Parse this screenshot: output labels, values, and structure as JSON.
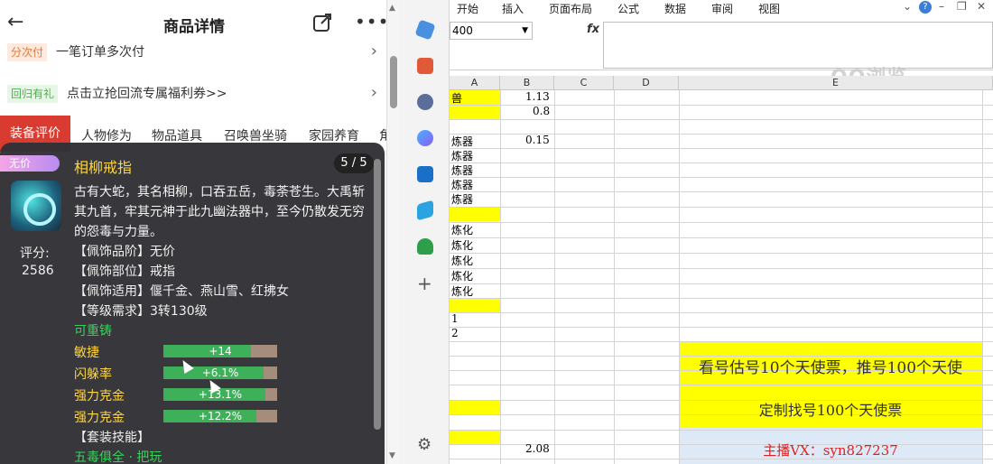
{
  "phone": {
    "title": "商品详情",
    "row1": {
      "tag": "分次付",
      "text": "一笔订单多次付"
    },
    "row2": {
      "tag": "回归有礼",
      "text": "点击立抢回流专属福利券>>"
    },
    "tabs": [
      "装备评价",
      "人物修为",
      "物品道具",
      "召唤兽坐骑",
      "家园养育",
      "角"
    ]
  },
  "card": {
    "badge": "无价",
    "name": "相柳戒指",
    "page": "5 / 5",
    "description": "古有大蛇，其名相柳，口吞五岳，毒荼苍生。大禹斩其九首，牢其元神于此九幽法器中，至今仍散发无穷的怨毒与力量。",
    "score_label": "评分:",
    "score": "2586",
    "attributes": [
      "【佩饰品阶】无价",
      "【佩饰部位】戒指",
      "【佩饰适用】偃千金、燕山雪、红拂女",
      "【等级需求】3转130级"
    ],
    "recast": "可重铸",
    "stats": [
      {
        "label": "敏捷",
        "value": "+14",
        "fill": 0.77
      },
      {
        "label": "闪躲率",
        "value": "+6.1%",
        "fill": 0.88
      },
      {
        "label": "强力克金",
        "value": "+13.1%",
        "fill": 0.9
      },
      {
        "label": "强力克金",
        "value": "+12.2%",
        "fill": 0.82
      }
    ],
    "set_title": "【套装技能】",
    "set_name": "五毒俱全 · 把玩"
  },
  "excel": {
    "menu": [
      "开始",
      "插入",
      "页面布局",
      "公式",
      "数据",
      "审阅",
      "视图"
    ],
    "name_box": "400",
    "fx": "fx",
    "watermark": "QQ浏览",
    "columns": [
      "A",
      "B",
      "C",
      "D",
      "E"
    ],
    "cells": {
      "a1": "兽",
      "b1": "1.13",
      "b2": "0.8",
      "a4": "炼器",
      "b4": "0.15",
      "a5": "炼器",
      "a6": "炼器",
      "a7": "炼器",
      "a8": "炼器",
      "a10": "炼化",
      "a11": "炼化",
      "a12": "炼化",
      "a13": "炼化",
      "a14": "炼化",
      "a16": "1",
      "a17": "2",
      "b24": "2.08"
    },
    "promo1": "看号估号10个天使票，推号100个天使",
    "promo2": "定制找号100个天使票",
    "promo3": "主播VX：syn827237"
  },
  "colors": {
    "yellow": "#ffff00",
    "red_tab": "#d93b30",
    "gold": "#ffd53d",
    "green": "#36d35a"
  }
}
